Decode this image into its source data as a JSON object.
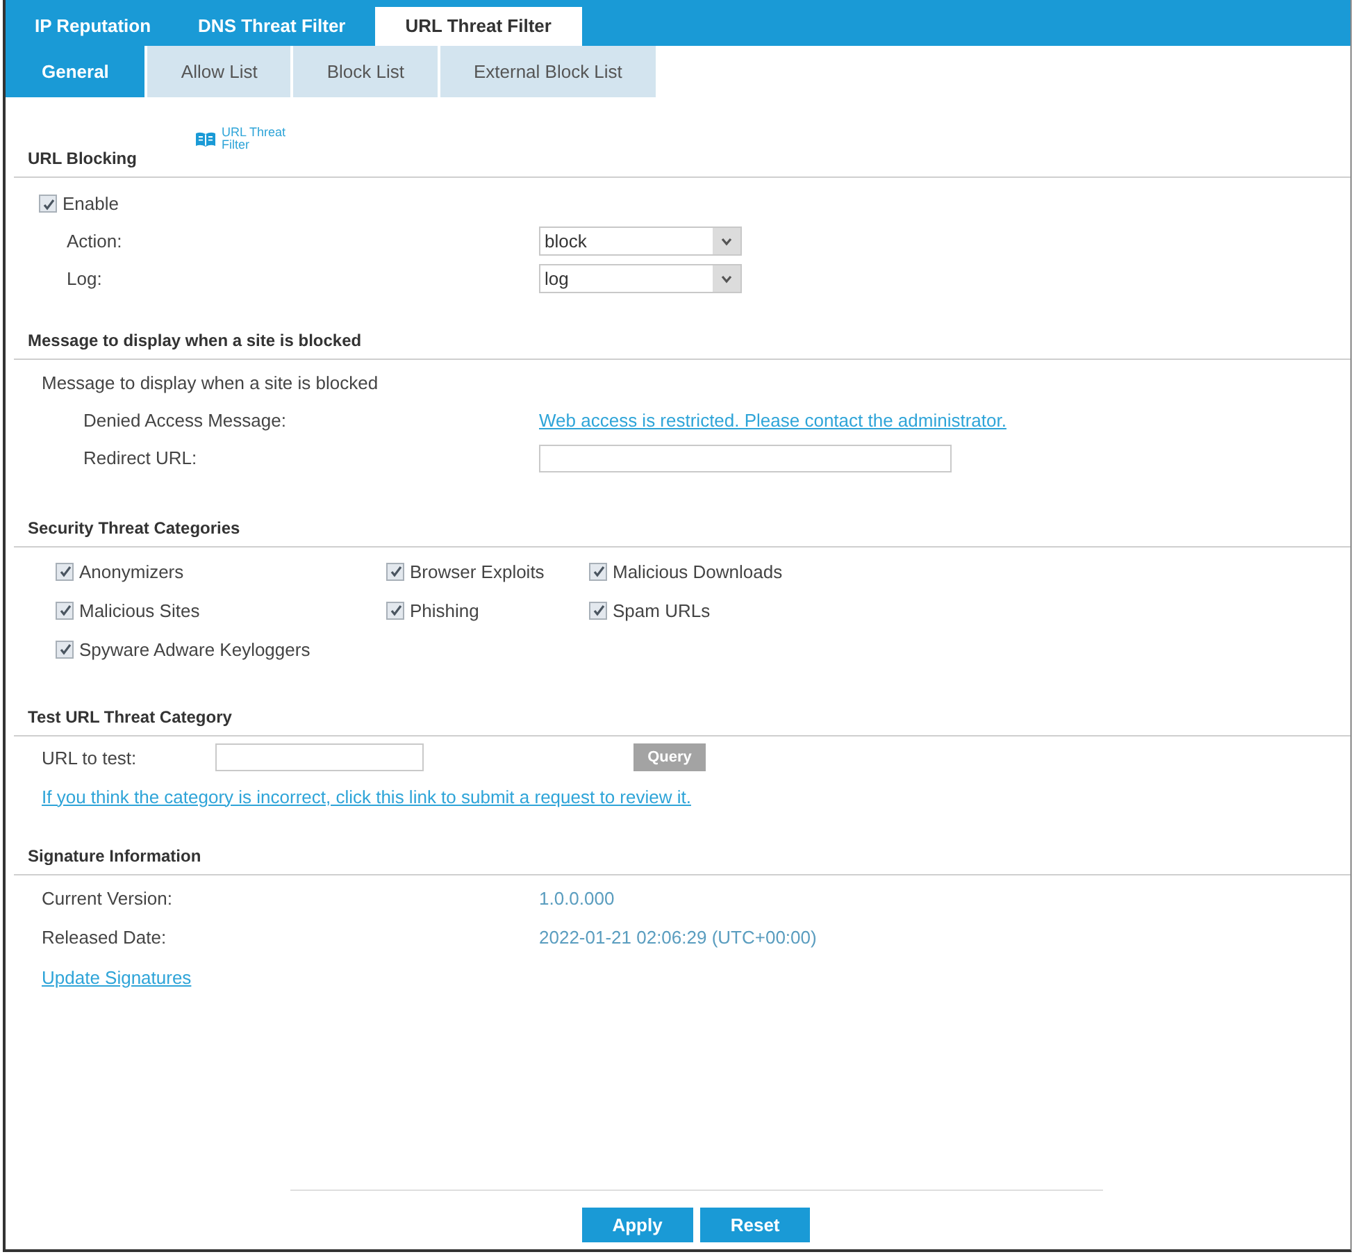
{
  "top_tabs": [
    {
      "label": "IP Reputation",
      "selected": false
    },
    {
      "label": "DNS Threat Filter",
      "selected": false
    },
    {
      "label": "URL Threat Filter",
      "selected": true
    }
  ],
  "sub_tabs": [
    {
      "label": "General",
      "selected": true
    },
    {
      "label": "Allow List",
      "selected": false
    },
    {
      "label": "Block List",
      "selected": false
    },
    {
      "label": "External Block List",
      "selected": false
    }
  ],
  "url_blocking": {
    "title": "URL Blocking",
    "help_link": "URL Threat Filter",
    "enable": {
      "label": "Enable",
      "checked": true
    },
    "fields": [
      {
        "label": "Action:",
        "value": "block"
      },
      {
        "label": "Log:",
        "value": "log"
      }
    ]
  },
  "blocked_message": {
    "title": "Message to display when a site is blocked",
    "subtitle": "Message to display when a site is blocked",
    "denied_access": {
      "label": "Denied Access Message:",
      "value": "Web access is restricted. Please contact the administrator."
    },
    "redirect_url": {
      "label": "Redirect URL:"
    }
  },
  "security_threat_categories": {
    "title": "Security Threat Categories",
    "items": [
      {
        "label": "Anonymizers",
        "checked": true
      },
      {
        "label": "Browser Exploits",
        "checked": true
      },
      {
        "label": "Malicious Downloads",
        "checked": true
      },
      {
        "label": "Malicious Sites",
        "checked": true
      },
      {
        "label": "Phishing",
        "checked": true
      },
      {
        "label": "Spam URLs",
        "checked": true
      },
      {
        "label": "Spyware Adware Keyloggers",
        "checked": true
      }
    ]
  },
  "test_url": {
    "title": "Test URL Threat Category",
    "url_label": "URL to test:",
    "query_button": {
      "label": "Query",
      "disabled": true
    },
    "review_link": "If you think the category is incorrect, click this link to submit a request to review it."
  },
  "signature_information": {
    "title": "Signature Information",
    "rows": [
      {
        "label": "Current Version:",
        "value": "1.0.0.000"
      },
      {
        "label": "Released Date:",
        "value": "2022-01-21 02:06:29 (UTC+00:00)"
      }
    ],
    "update_link": "Update Signatures"
  },
  "buttons": [
    "Apply",
    "Reset"
  ]
}
